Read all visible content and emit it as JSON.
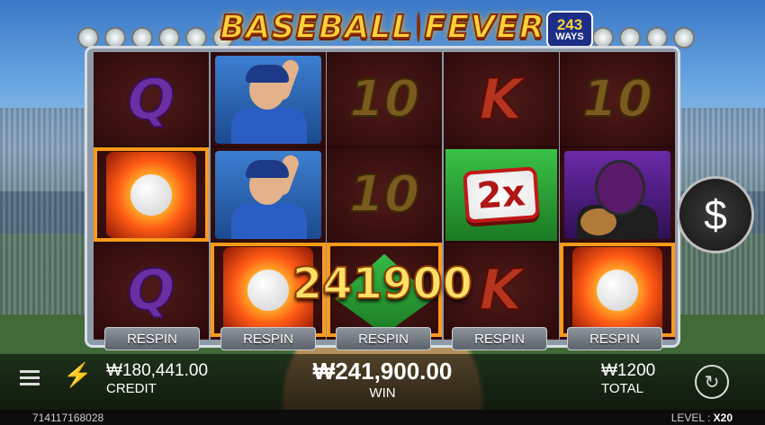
{
  "logo": {
    "word1": "BASEBALL",
    "word2": "FEVER",
    "ways_number": "243",
    "ways_label": "WAYS"
  },
  "reels": [
    [
      "Q",
      "ball",
      "Q"
    ],
    [
      "pitcher",
      "pitcher",
      "ball"
    ],
    [
      "10",
      "10",
      "diamond"
    ],
    [
      "K",
      "2x",
      "K"
    ],
    [
      "10",
      "catcher",
      "ball"
    ]
  ],
  "multiplier": "2x",
  "win_overlay": "241900",
  "respin_label": "RESPIN",
  "dollar_button": "$",
  "footer_bar": {
    "credit_value": "₩180,441.00",
    "credit_label": "CREDIT",
    "win_value": "₩241,900.00",
    "win_label": "WIN",
    "total_value": "₩1200",
    "total_label": "TOTAL"
  },
  "footer": {
    "round_id": "714117168028",
    "level_label": "LEVEL :",
    "level_value": "X20"
  }
}
